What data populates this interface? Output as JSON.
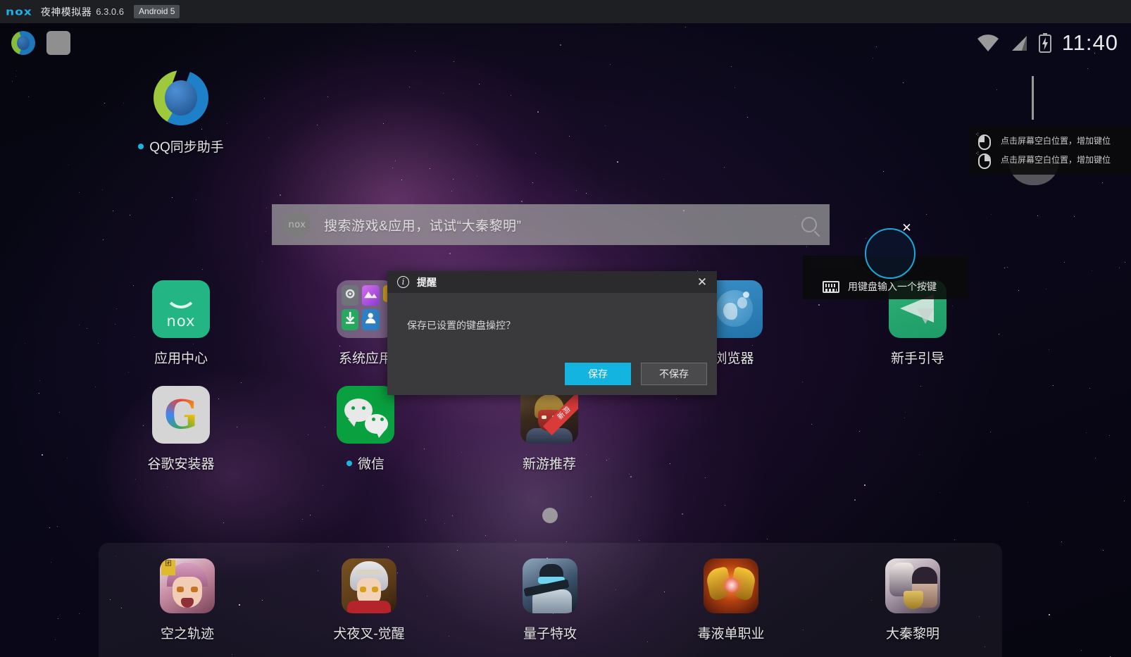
{
  "titlebar": {
    "logo": "nox",
    "app_name": "夜神模拟器",
    "version": "6.3.0.6",
    "android_badge": "Android 5"
  },
  "statusbar": {
    "clock": "11:40",
    "icons": [
      "wifi-icon",
      "signal-icon",
      "battery-charging-icon"
    ],
    "left_icons": [
      "qq-sync-icon",
      "recents-square-icon"
    ]
  },
  "search": {
    "placeholder": "搜索游戏&应用，试试“大秦黎明”",
    "logo": "nox",
    "value": ""
  },
  "desktop": {
    "icons": [
      {
        "label": "QQ同步助手",
        "has_dot": true,
        "kind": "qqsync"
      },
      {
        "label": "应用中心",
        "has_dot": false,
        "kind": "noxstore"
      },
      {
        "label": "系统应用",
        "has_dot": false,
        "kind": "folder"
      },
      {
        "label": "浏览器",
        "has_dot": false,
        "kind": "browser"
      },
      {
        "label": "新手引导",
        "has_dot": false,
        "kind": "guide"
      },
      {
        "label": "谷歌安装器",
        "has_dot": false,
        "kind": "google"
      },
      {
        "label": "微信",
        "has_dot": true,
        "kind": "wechat"
      },
      {
        "label": "新游推荐",
        "has_dot": false,
        "kind": "newgame",
        "badge": "新游"
      }
    ],
    "folder_apps": [
      "settings-icon",
      "gallery-icon",
      "notes-icon",
      "downloads-icon",
      "contacts-icon"
    ]
  },
  "dock": {
    "items": [
      {
        "label": "空之轨迹",
        "kind": "kong"
      },
      {
        "label": "犬夜叉-觉醒",
        "kind": "inu"
      },
      {
        "label": "量子特攻",
        "kind": "quantum"
      },
      {
        "label": "毒液单职业",
        "kind": "venom"
      },
      {
        "label": "大秦黎明",
        "kind": "daqin"
      }
    ]
  },
  "keymap_overlay": {
    "hints": [
      {
        "icon": "mouse-left-click-icon",
        "text": "点击屏幕空白位置，增加键位"
      },
      {
        "icon": "mouse-right-click-icon",
        "text": "点击屏幕空白位置，增加键位"
      }
    ],
    "keyboard_hint": {
      "icon": "keyboard-icon",
      "text": "用键盘输入一个按键"
    },
    "key_marker": {
      "close": "✕",
      "color": "#19a9d4"
    }
  },
  "dialog": {
    "title": "提醒",
    "close": "✕",
    "message": "保存已设置的键盘操控？",
    "primary_button": "保存",
    "secondary_button": "不保存",
    "primary_color": "#13b5e0"
  }
}
